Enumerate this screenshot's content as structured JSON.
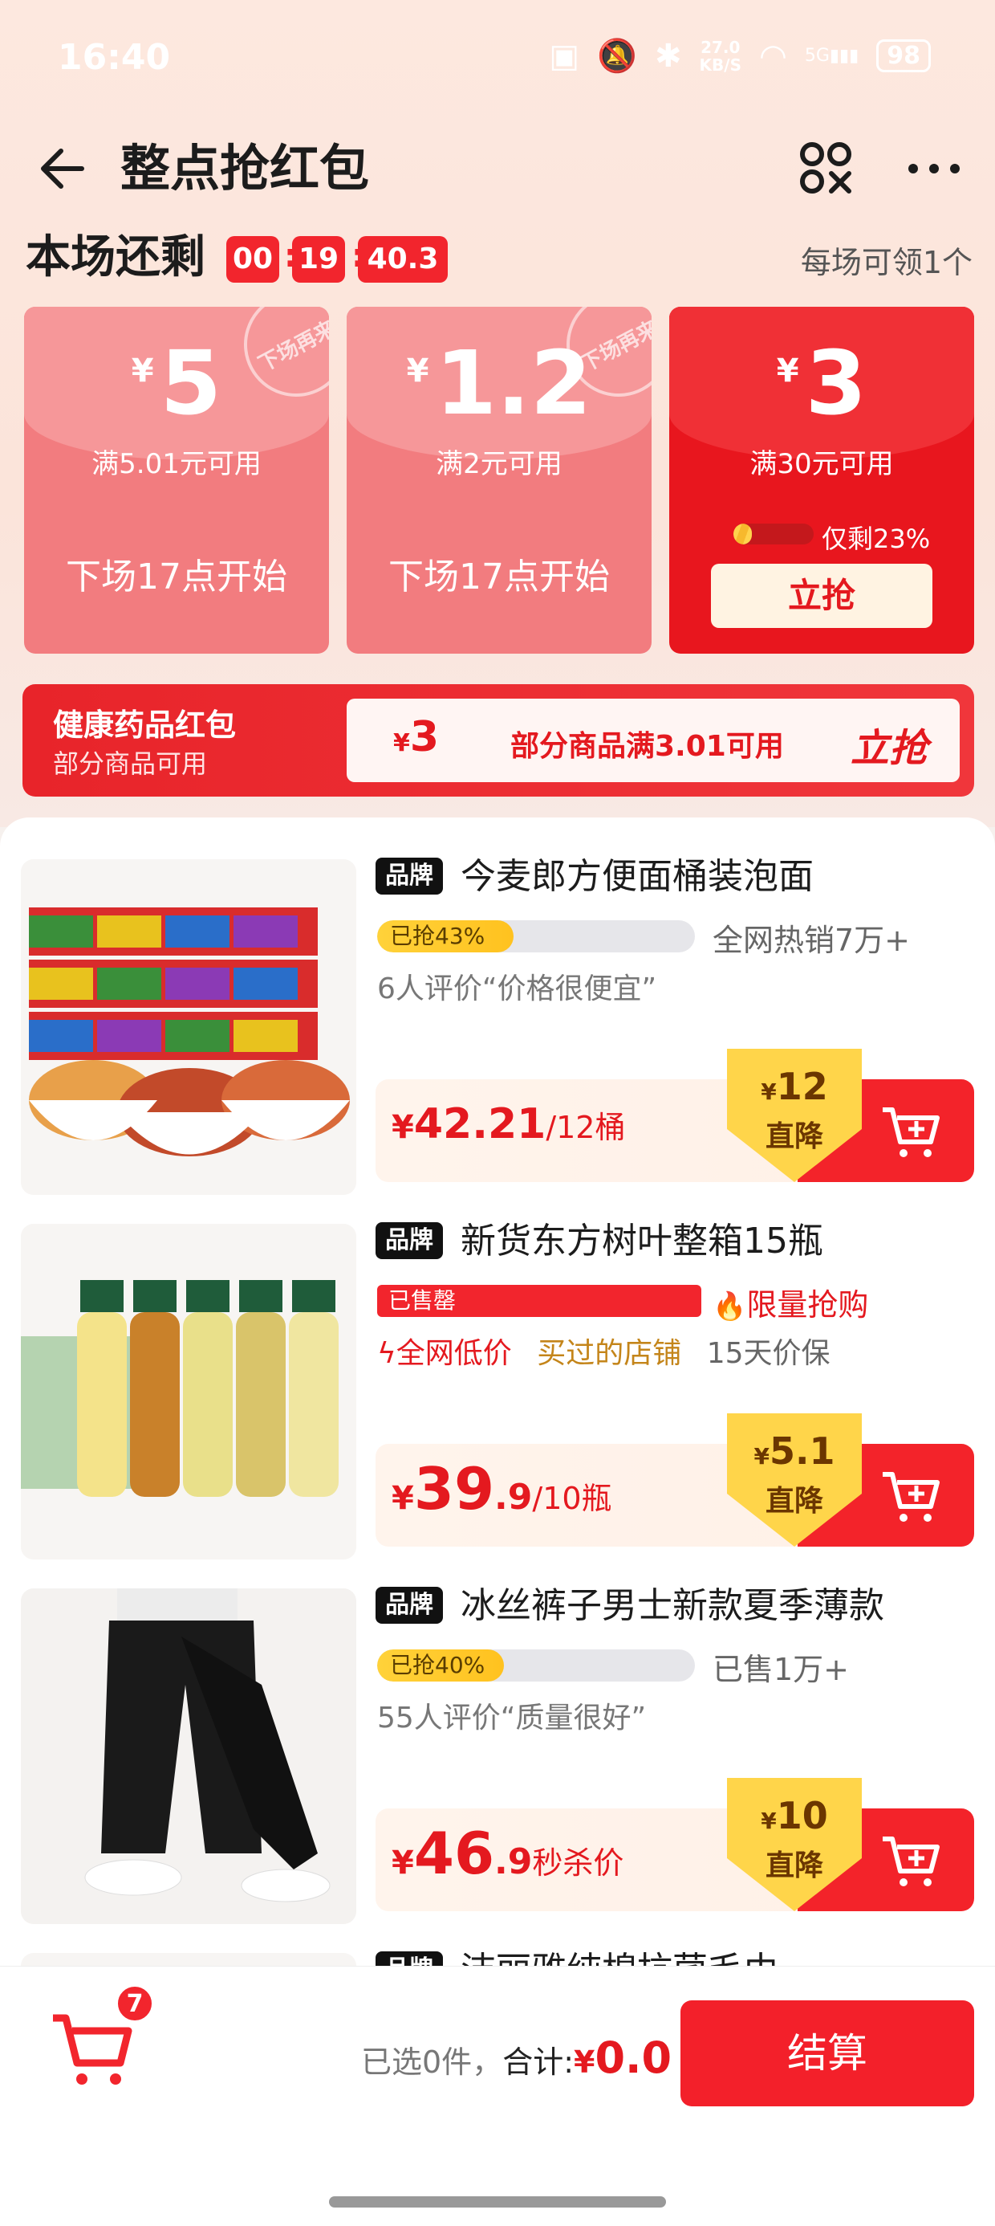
{
  "status_bar": {
    "time": "16:40",
    "speed_top": "27.0",
    "speed_bottom": "KB/S",
    "signal": "5G",
    "battery": "98"
  },
  "header": {
    "title": "整点抢红包"
  },
  "countdown": {
    "label": "本场还剩",
    "hours": "00",
    "minutes": "19",
    "seconds": "40.3",
    "sep": ":",
    "per_session": "每场可领1个"
  },
  "coupons": [
    {
      "yen": "¥",
      "amount": "5",
      "condition": "满5.01元可用",
      "next": "下场17点开始",
      "stamp": "下场再来"
    },
    {
      "yen": "¥",
      "amount": "1.2",
      "condition": "满2元可用",
      "next": "下场17点开始",
      "stamp": "下场再来"
    },
    {
      "yen": "¥",
      "amount": "3",
      "condition": "满30元可用",
      "remain": "仅剩23%",
      "remain_fraction": 0.23,
      "button": "立抢"
    }
  ],
  "health": {
    "title": "健康药品红包",
    "sub": "部分商品可用",
    "yen": "¥",
    "amount": "3",
    "condition": "部分商品满3.01可用",
    "button": "立抢"
  },
  "products": [
    {
      "brand": "品牌",
      "name": "今麦郎方便面桶装泡面",
      "progress_label": "已抢43%",
      "progress": 0.43,
      "sales": "全网热销7万+",
      "review": "6人评价“价格很便宜”",
      "price_yen": "¥",
      "price_int": "42.21",
      "price_dec": "",
      "price_unit": "/12桶",
      "drop_yen": "¥",
      "drop_amount": "12",
      "drop_label": "直降"
    },
    {
      "brand": "品牌",
      "name": "新货东方树叶整箱15瓶",
      "sold_out": "已售罄",
      "limit": "限量抢购",
      "tag1": "全网低价",
      "tag2": "买过的店铺",
      "tag3": "15天价保",
      "price_yen": "¥",
      "price_int": "39",
      "price_dec": ".9",
      "price_unit": "/10瓶",
      "drop_yen": "¥",
      "drop_amount": "5.1",
      "drop_label": "直降"
    },
    {
      "brand": "品牌",
      "name": "冰丝裤子男士新款夏季薄款",
      "progress_label": "已抢40%",
      "progress": 0.4,
      "sales": "已售1万+",
      "review": "55人评价“质量很好”",
      "price_yen": "¥",
      "price_int": "46",
      "price_dec": ".9",
      "price_unit": "秒杀价",
      "drop_yen": "¥",
      "drop_amount": "10",
      "drop_label": "直降"
    },
    {
      "brand": "品牌",
      "name": "洁丽雅纯棉抗菌毛巾"
    }
  ],
  "footer": {
    "cart_count": "7",
    "selected": "已选0件，",
    "total_label": "合计:",
    "total_yen": "¥",
    "total_amount": "0.0",
    "checkout": "结算"
  },
  "colors": {
    "accent": "#f2252d",
    "gold": "#ffc21f"
  }
}
